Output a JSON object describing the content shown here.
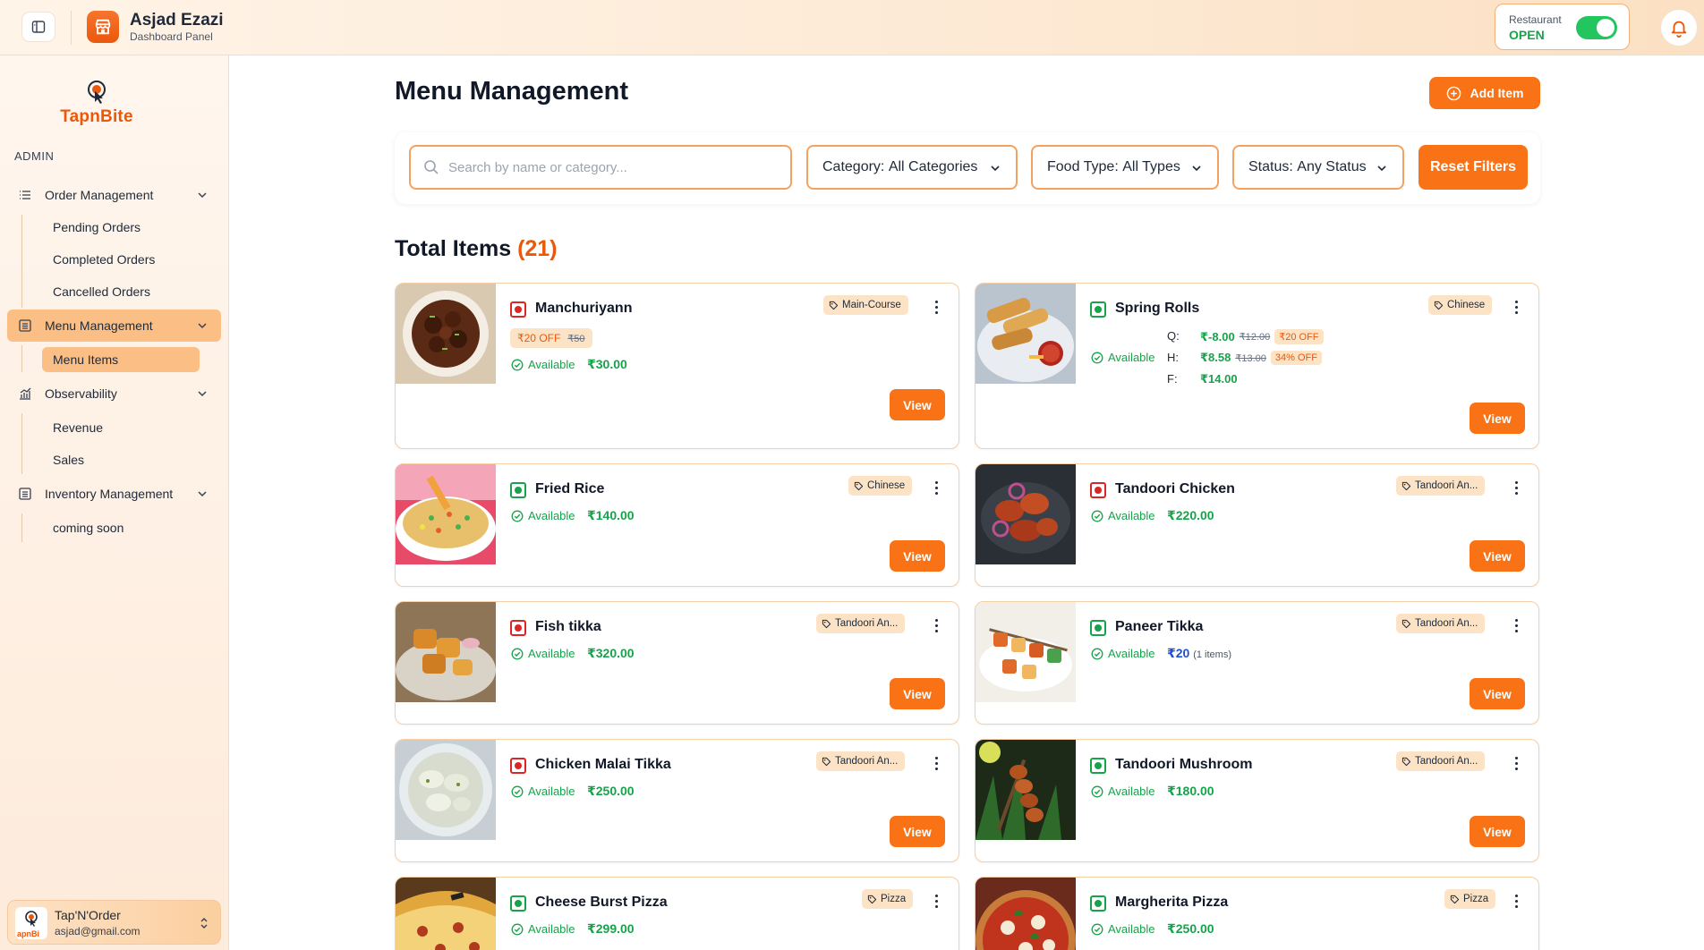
{
  "topbar": {
    "user_name": "Asjad Ezazi",
    "user_subtitle": "Dashboard Panel",
    "status_label": "Restaurant",
    "status_value": "OPEN",
    "status_on": true
  },
  "sidebar": {
    "logo_brand_a": "Tapn",
    "logo_brand_b": "Bite",
    "section_label": "ADMIN",
    "items": [
      {
        "label": "Order Management",
        "icon": "list-icon"
      },
      {
        "label": "Pending Orders"
      },
      {
        "label": "Completed Orders"
      },
      {
        "label": "Cancelled Orders"
      },
      {
        "label": "Menu Management",
        "icon": "menu-icon"
      },
      {
        "label": "Menu Items"
      },
      {
        "label": "Observability",
        "icon": "chart-icon"
      },
      {
        "label": "Revenue"
      },
      {
        "label": "Sales"
      },
      {
        "label": "Inventory Management",
        "icon": "inventory-icon"
      },
      {
        "label": "coming soon"
      }
    ],
    "profile": {
      "name": "Tap'N'Order",
      "email": "asjad@gmail.com"
    }
  },
  "main": {
    "title": "Menu Management",
    "add_label": "Add Item",
    "search_placeholder": "Search by name or category...",
    "filters": [
      {
        "prefix": "Category:",
        "value": "All Categories"
      },
      {
        "prefix": "Food Type:",
        "value": "All Types"
      },
      {
        "prefix": "Status:",
        "value": "Any Status"
      }
    ],
    "reset_label": "Reset Filters",
    "total_label": "Total Items",
    "total_count": "(21)"
  },
  "items": [
    {
      "name": "Manchuriyann",
      "veg": false,
      "category": "Main-Course",
      "status": "Available",
      "price": "₹30.00",
      "discount": "₹20 OFF",
      "original": "₹50",
      "view": "View"
    },
    {
      "name": "Spring Rolls",
      "veg": true,
      "category": "Chinese",
      "status": "Available",
      "view": "View",
      "variants": [
        {
          "label": "Q:",
          "price": "₹-8.00",
          "original": "₹12.00",
          "off": "₹20 OFF"
        },
        {
          "label": "H:",
          "price": "₹8.58",
          "original": "₹13.00",
          "off": "34% OFF"
        },
        {
          "label": "F:",
          "price": "₹14.00"
        }
      ]
    },
    {
      "name": "Fried Rice",
      "veg": true,
      "category": "Chinese",
      "status": "Available",
      "price": "₹140.00",
      "view": "View"
    },
    {
      "name": "Tandoori Chicken",
      "veg": false,
      "category": "Tandoori An...",
      "status": "Available",
      "price": "₹220.00",
      "view": "View"
    },
    {
      "name": "Fish tikka",
      "veg": false,
      "category": "Tandoori An...",
      "status": "Available",
      "price": "₹320.00",
      "view": "View"
    },
    {
      "name": "Paneer Tikka",
      "veg": true,
      "category": "Tandoori An...",
      "status": "Available",
      "price": "₹20",
      "price_note": "(1 items)",
      "view": "View"
    },
    {
      "name": "Chicken Malai Tikka",
      "veg": false,
      "category": "Tandoori An...",
      "status": "Available",
      "price": "₹250.00",
      "view": "View"
    },
    {
      "name": "Tandoori Mushroom",
      "veg": true,
      "category": "Tandoori An...",
      "status": "Available",
      "price": "₹180.00",
      "view": "View"
    },
    {
      "name": "Cheese Burst Pizza",
      "veg": true,
      "category": "Pizza",
      "status": "Available",
      "price": "₹299.00",
      "view": "View"
    },
    {
      "name": "Margherita Pizza",
      "veg": true,
      "category": "Pizza",
      "status": "Available",
      "price": "₹250.00",
      "view": "View"
    }
  ],
  "colors": {
    "accent": "#f97316",
    "veg": "#16a34a",
    "nonveg": "#dc2626",
    "available": "#16a34a"
  }
}
